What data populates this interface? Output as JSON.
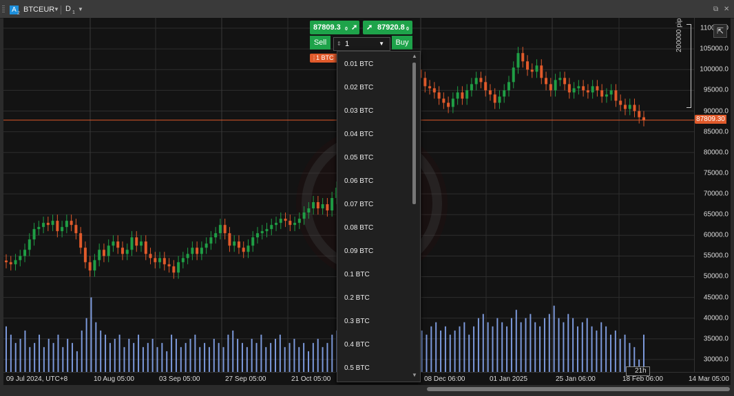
{
  "header": {
    "symbol_icon": "A",
    "symbol_icon_sub": "2",
    "symbol": "BTCEUR",
    "timeframe": "D",
    "timeframe_sub": "1",
    "popout_icon": "popout-icon",
    "close_icon": "close-icon"
  },
  "trade_panel": {
    "sell_price": "87809.3",
    "sell_price_sup": "0",
    "buy_price": "87920.8",
    "buy_price_sup": "0",
    "sell_label": "Sell",
    "buy_label": "Buy",
    "quantity_value": "1",
    "position_tag": "1 BTC"
  },
  "quantity_dropdown": {
    "options": [
      "0.01 BTC",
      "0.02 BTC",
      "0.03 BTC",
      "0.04 BTC",
      "0.05 BTC",
      "0.06 BTC",
      "0.07 BTC",
      "0.08 BTC",
      "0.09 BTC",
      "0.1 BTC",
      "0.2 BTC",
      "0.3 BTC",
      "0.4 BTC",
      "0.5 BTC"
    ]
  },
  "chart": {
    "current_price_label": "87809.30",
    "pips_label": "200000 pips",
    "countdown": "21h",
    "colors": {
      "up": "#1f9e45",
      "down": "#e05a2b",
      "volume": "#8fb1ff",
      "price_line": "#e05a2b"
    }
  },
  "chart_data": {
    "type": "candlestick",
    "y_ticks": [
      "110000.0",
      "105000.0",
      "100000.0",
      "95000.0",
      "90000.0",
      "85000.0",
      "80000.0",
      "75000.0",
      "70000.0",
      "65000.0",
      "60000.0",
      "55000.0",
      "50000.0",
      "45000.0",
      "40000.0",
      "35000.0",
      "30000.0"
    ],
    "y_tick_values": [
      110000,
      105000,
      100000,
      95000,
      90000,
      85000,
      80000,
      75000,
      70000,
      65000,
      60000,
      55000,
      50000,
      45000,
      40000,
      35000,
      30000
    ],
    "x_ticks": [
      "09 Jul 2024, UTC+8",
      "10 Aug 05:00",
      "03 Sep 05:00",
      "27 Sep 05:00",
      "21 Oct 05:00",
      "08 Dec 06:00",
      "01 Jan 2025",
      "25 Jan 06:00",
      "18 Feb 06:00",
      "14 Mar 05:00"
    ],
    "ylim": [
      27000,
      112500
    ],
    "current_price": 87809.3,
    "series": [
      {
        "name": "Close",
        "values": [
          53500,
          53000,
          54000,
          55000,
          56500,
          59000,
          61500,
          62000,
          63000,
          62500,
          63500,
          61000,
          62000,
          63500,
          62500,
          60500,
          57000,
          53500,
          51500,
          54000,
          56500,
          55000,
          57500,
          58500,
          57000,
          55500,
          56500,
          59500,
          57500,
          58500,
          55500,
          54500,
          53500,
          54500,
          53000,
          52500,
          51000,
          53500,
          54500,
          55500,
          57000,
          55500,
          57000,
          58000,
          59500,
          60500,
          62500,
          60500,
          57500,
          58500,
          57000,
          56000,
          57500,
          59500,
          60500,
          61000,
          61500,
          62500,
          63000,
          64000,
          63500,
          62500,
          63000,
          64000,
          65500,
          66500,
          68000,
          66500,
          67500,
          66000,
          69000,
          71500,
          69500,
          72500,
          76000,
          79000,
          84000,
          88000,
          87000,
          90000,
          91500,
          92500,
          94000,
          96000,
          95000,
          96500,
          97500,
          99000,
          100000,
          98000,
          96000,
          95500,
          94500,
          93000,
          92000,
          91000,
          93000,
          94500,
          93000,
          95000,
          96500,
          98000,
          97000,
          95000,
          94000,
          92000,
          93500,
          95000,
          97000,
          100500,
          104000,
          102000,
          100000,
          99500,
          101000,
          98000,
          96500,
          95000,
          97500,
          98000,
          96500,
          94500,
          95500,
          96000,
          95000,
          94500,
          96000,
          95000,
          93500,
          94000,
          95000,
          92500,
          91500,
          90500,
          91500,
          90000,
          88500,
          87809
        ]
      }
    ],
    "volume_ylim_note": "relative"
  },
  "volume_data": [
    38000,
    36000,
    34000,
    35000,
    37000,
    33000,
    34000,
    36000,
    33000,
    35000,
    34000,
    36000,
    33000,
    35000,
    34000,
    32000,
    37000,
    40000,
    45000,
    39000,
    37000,
    36000,
    34000,
    35000,
    36000,
    33000,
    35000,
    34000,
    36000,
    33000,
    34000,
    35000,
    33000,
    34000,
    32000,
    36000,
    35000,
    33000,
    34000,
    35000,
    36000,
    33000,
    34000,
    33000,
    35000,
    34000,
    33000,
    36000,
    37000,
    35000,
    34000,
    33000,
    35000,
    34000,
    36000,
    33000,
    34000,
    35000,
    36000,
    33000,
    34000,
    35000,
    33000,
    34000,
    32000,
    34000,
    35000,
    33000,
    34000,
    36000,
    37000,
    35000,
    36000,
    38000,
    39000,
    40000,
    38000,
    37000,
    39000,
    36000,
    38000,
    37000,
    36000,
    38000,
    39000,
    36000,
    37000,
    38000,
    37000,
    36000,
    38000,
    39000,
    37000,
    38000,
    36000,
    37000,
    38000,
    39000,
    36000,
    38000,
    40000,
    41000,
    39000,
    38000,
    40000,
    39000,
    38000,
    40000,
    42000,
    39000,
    40000,
    41000,
    39000,
    38000,
    40000,
    41000,
    43000,
    40000,
    39000,
    41000,
    40000,
    38000,
    39000,
    40000,
    38000,
    37000,
    39000,
    38000,
    36000,
    37000,
    35000,
    36000,
    34000,
    33000,
    30000,
    36000
  ]
}
